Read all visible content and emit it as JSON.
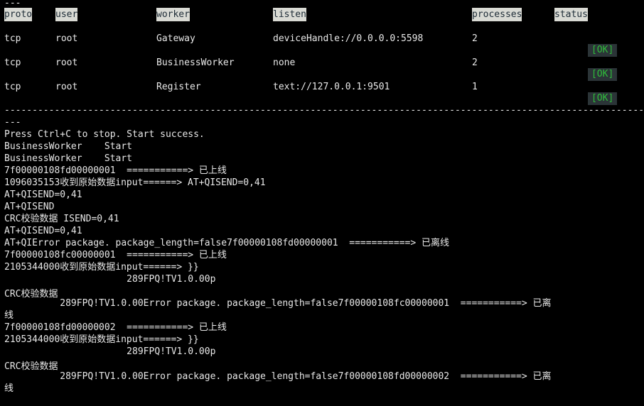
{
  "terminal": {
    "background_color": "#000000",
    "foreground_color": "#e8e8e8",
    "header_background_color": "#d9dad4",
    "header_foreground_color": "#1d2b36",
    "status_badge_background_color": "#2b3437",
    "status_badge_foreground_color": "#2fbf3a",
    "top_truncated_rule": "---"
  },
  "table": {
    "columns": [
      {
        "key": "proto",
        "label": "proto"
      },
      {
        "key": "user",
        "label": "user"
      },
      {
        "key": "worker",
        "label": "worker"
      },
      {
        "key": "listen",
        "label": "listen"
      },
      {
        "key": "processes",
        "label": "processes"
      },
      {
        "key": "status",
        "label": "status"
      }
    ],
    "rows": [
      {
        "proto": "tcp",
        "user": "root",
        "worker": "Gateway",
        "listen": "deviceHandle://0.0.0.0:5598",
        "processes": "2",
        "status": "[OK]"
      },
      {
        "proto": "tcp",
        "user": "root",
        "worker": "BusinessWorker",
        "listen": "none",
        "processes": "2",
        "status": "[OK]"
      },
      {
        "proto": "tcp",
        "user": "root",
        "worker": "Register",
        "listen": "text://127.0.0.1:9501",
        "processes": "1",
        "status": "[OK]"
      }
    ]
  },
  "separator": {
    "dashes": "------------------------------------------------------------------------------------------------------------------------------------------",
    "trailing": "---"
  },
  "log": {
    "lines": [
      {
        "text": "Press Ctrl+C to stop. Start success."
      },
      {
        "text": "BusinessWorker    Start"
      },
      {
        "text": "BusinessWorker    Start"
      },
      {
        "text": "7f00000108fd00000001  ===========> 已上线"
      },
      {
        "text": "1096035153收到原始数据input======> AT+QISEND=0,41"
      },
      {
        "text": "AT+QISEND=0,41"
      },
      {
        "text": "AT+QISEND"
      },
      {
        "text": "CRC校验数据 ISEND=0,41"
      },
      {
        "text": "AT+QISEND=0,41"
      },
      {
        "text": "AT+QIError package. package_length=false7f00000108fd00000001  ===========> 已离线"
      },
      {
        "text": "7f00000108fc00000001  ===========> 已上线"
      },
      {
        "text": "2105344000收到原始数据input======> }}"
      },
      {
        "text": "                      289FPQ!TV1.0.00p",
        "indent": true
      },
      {
        "text": "CRC校验数据"
      },
      {
        "text": "          289FPQ!TV1.0.00Error package. package_length=false7f00000108fc00000001  ===========> 已离",
        "indent": true
      },
      {
        "text": "线"
      },
      {
        "text": "7f00000108fd00000002  ===========> 已上线"
      },
      {
        "text": "2105344000收到原始数据input======> }}"
      },
      {
        "text": "                      289FPQ!TV1.0.00p",
        "indent": true
      },
      {
        "text": "CRC校验数据"
      },
      {
        "text": "          289FPQ!TV1.0.00Error package. package_length=false7f00000108fd00000002  ===========> 已离",
        "indent": true
      },
      {
        "text": "线"
      }
    ]
  }
}
